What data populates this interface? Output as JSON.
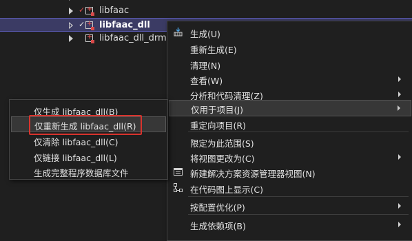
{
  "tree": {
    "rows": [
      {
        "label": "libfaac",
        "checked": true
      },
      {
        "label": "libfaac_dll",
        "checked": true,
        "selected": true
      },
      {
        "label": "libfaac_dll_drm",
        "checked": false
      }
    ]
  },
  "context_menu": {
    "items": {
      "build": "生成(U)",
      "rebuild": "重新生成(E)",
      "clean": "清理(N)",
      "view": "查看(W)",
      "analyze": "分析和代码清理(Z)",
      "project_only": "仅用于项目(J)",
      "retarget": "重定向项目(R)",
      "scope_to_this": "限定为此范围(S)",
      "change_view_to": "将视图更改为(C)",
      "new_explorer_view": "新建解决方案资源管理器视图(N)",
      "show_on_code_map": "在代码图上显示(C)",
      "profile_guided": "按配置优化(P)",
      "build_dependencies": "生成依赖项(B)"
    }
  },
  "submenu": {
    "items": {
      "build_only": "仅生成 libfaac_dll(B)",
      "rebuild_only": "仅重新生成 libfaac_dll(R)",
      "clean_only": "仅清除 libfaac_dll(C)",
      "link_only": "仅链接 libfaac_dll(L)",
      "full_pdb": "生成完整程序数据库文件"
    }
  },
  "colors": {
    "background": "#1f1f1f",
    "selection": "#3b3b64",
    "highlight_box": "#d9332d"
  }
}
